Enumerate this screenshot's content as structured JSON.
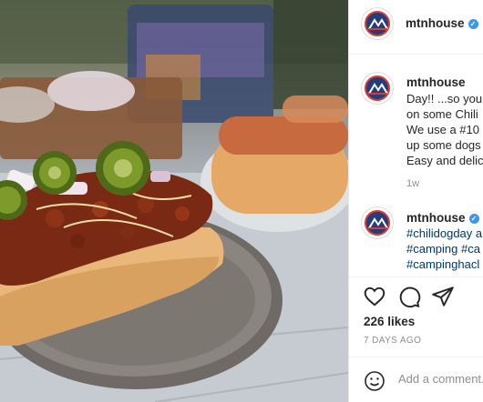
{
  "header": {
    "username": "mtnhouse",
    "verified": true
  },
  "post_caption": {
    "username": "mtnhouse",
    "lines": [
      "Day!! ...so you",
      "on some Chili",
      "We use a #10",
      "up some dogs",
      "Easy and delic"
    ],
    "time": "1w"
  },
  "comment": {
    "username": "mtnhouse",
    "lines": [
      "#chilidogday a",
      "#camping #ca",
      "#campinghacl"
    ]
  },
  "actions": {
    "like_icon": "heart-icon",
    "comment_icon": "comment-bubble-icon",
    "share_icon": "paper-plane-icon"
  },
  "likes": "226 likes",
  "posted_ago": "7 DAYS AGO",
  "add_comment": {
    "placeholder": "Add a comment...",
    "emoji_icon": "smiley-icon"
  },
  "colors": {
    "verified_blue": "#3897f0",
    "brand_navy": "#233e7a",
    "brand_red": "#e03a2f",
    "hashtag": "#00376b"
  }
}
